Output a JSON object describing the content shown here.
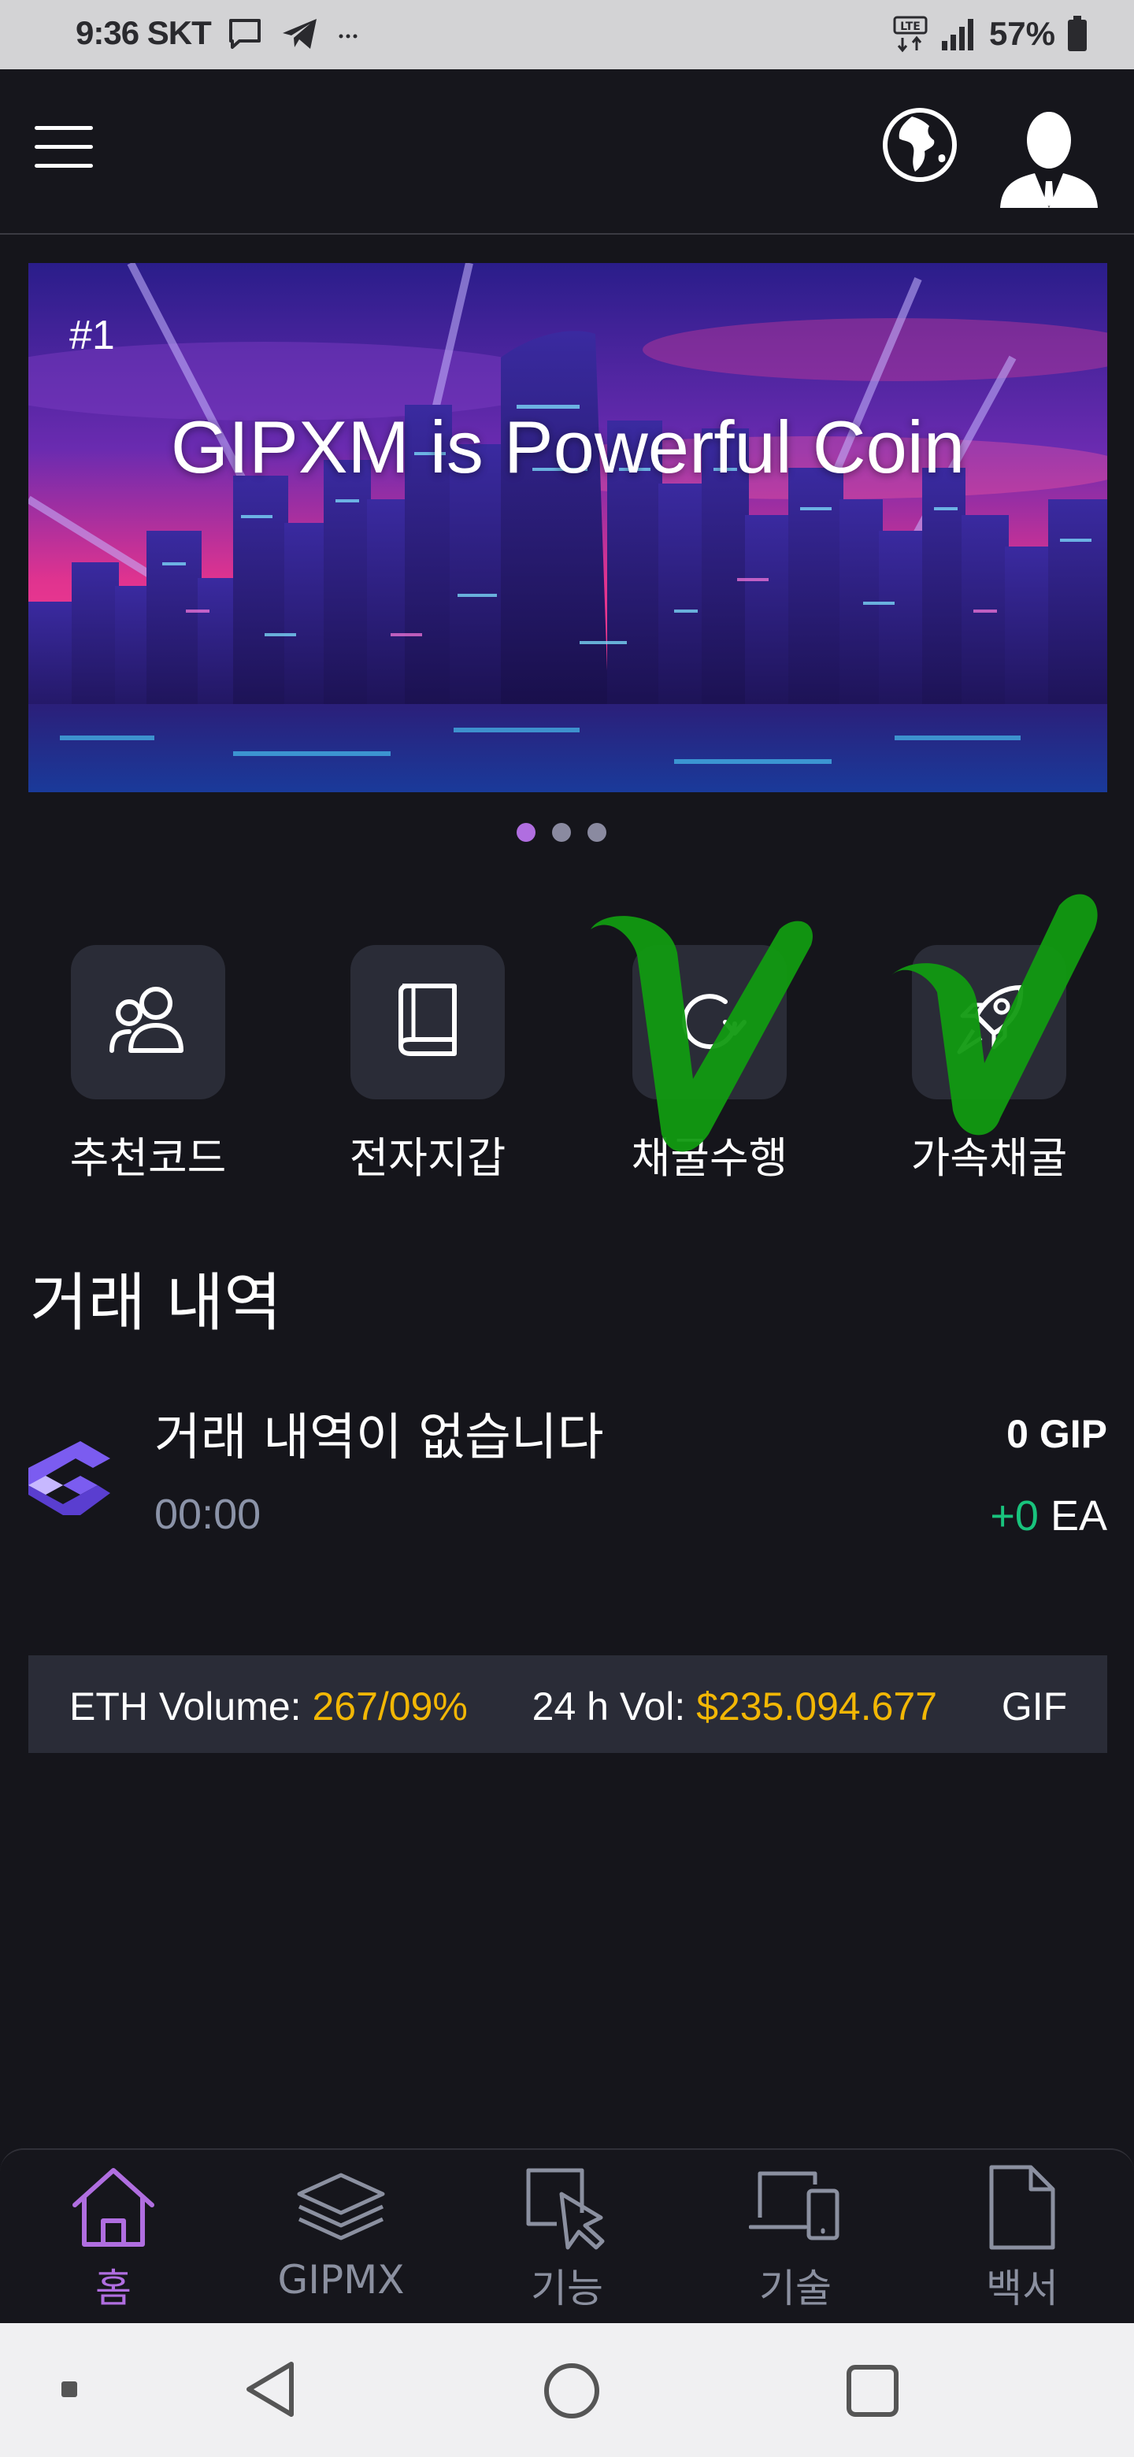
{
  "status_bar": {
    "time": "9:36 SKT",
    "network": "LTE",
    "battery": "57%",
    "icons": [
      "chat-icon",
      "telegram-icon",
      "more-icon",
      "lte-icon",
      "signal-icon",
      "battery-icon"
    ]
  },
  "header": {
    "icons": [
      "menu-icon",
      "globe-icon",
      "user-avatar"
    ]
  },
  "banner": {
    "slide_number": "#1",
    "headline": "GIPXM is Powerful Coin",
    "total_slides": 3,
    "active_slide": 1
  },
  "actions": [
    {
      "label": "추천코드",
      "icon": "users-icon"
    },
    {
      "label": "전자지갑",
      "icon": "book-icon"
    },
    {
      "label": "채굴수행",
      "icon": "refresh-icon"
    },
    {
      "label": "가속채굴",
      "icon": "rocket-icon"
    }
  ],
  "history": {
    "title": "거래 내역",
    "empty_message": "거래 내역이 없습니다",
    "time": "00:00",
    "amount": "0 GIP",
    "delta": "+0",
    "delta_unit": "EA"
  },
  "ticker": {
    "eth_label": "ETH Volume:",
    "eth_value": "267/09%",
    "vol_label": "24 h Vol:",
    "vol_value": "$235.094.677",
    "next_label": "GIF"
  },
  "bottom_nav": {
    "items": [
      {
        "label": "홈",
        "icon": "home-icon",
        "active": true
      },
      {
        "label": "GIPMX",
        "icon": "layers-icon",
        "active": false
      },
      {
        "label": "기능",
        "icon": "cursor-icon",
        "active": false
      },
      {
        "label": "기술",
        "icon": "devices-icon",
        "active": false
      },
      {
        "label": "백서",
        "icon": "document-icon",
        "active": false
      }
    ]
  },
  "colors": {
    "background": "#15151b",
    "accent_purple": "#b06ee0",
    "positive_green": "#19c37d",
    "ticker_gold": "#f2b705",
    "tile_bg": "#2a2c37",
    "checkmark_green": "#119a11"
  }
}
